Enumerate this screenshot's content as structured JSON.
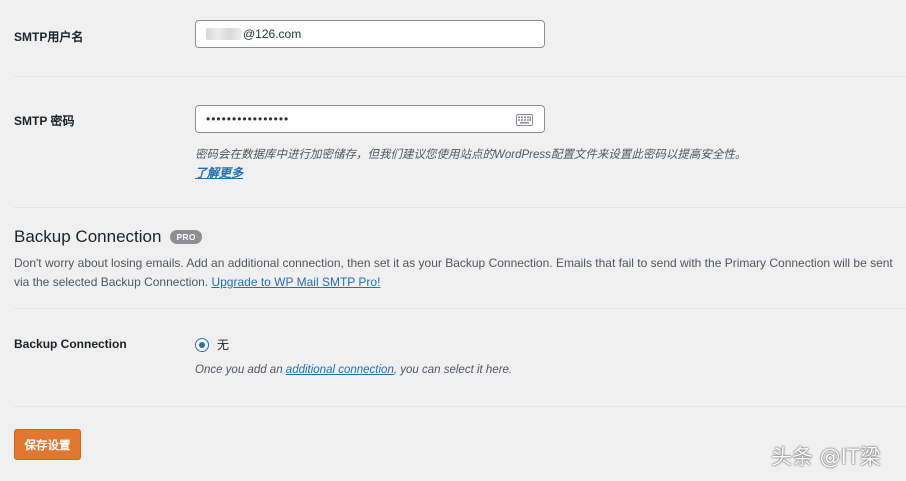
{
  "smtp_user": {
    "label": "SMTP用户名",
    "value": "@126.com"
  },
  "smtp_pass": {
    "label": "SMTP 密码",
    "value": "••••••••••••••••",
    "description": "密码会在数据库中进行加密储存，但我们建议您使用站点的WordPress配置文件来设置此密码以提高安全性。",
    "learn_more": "了解更多"
  },
  "backup": {
    "heading": "Backup Connection",
    "badge": "PRO",
    "paragraph_text": "Don't worry about losing emails. Add an additional connection, then set it as your Backup Connection. Emails that fail to send with the Primary Connection will be sent via the selected Backup Connection.",
    "upgrade_link": "Upgrade to WP Mail SMTP Pro!",
    "field_label": "Backup Connection",
    "option_label": "无",
    "option_selected": true,
    "note_prefix": "Once you add an",
    "note_link": "additional connection",
    "note_suffix": ", you can select it here."
  },
  "save_button": "保存设置",
  "watermark": "头条 @IT梁",
  "colors": {
    "accent": "#2271b1",
    "button": "#e27730",
    "background": "#f0f0f1"
  }
}
